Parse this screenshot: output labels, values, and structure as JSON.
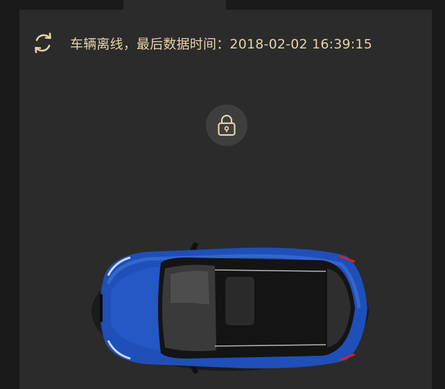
{
  "status": {
    "message": "车辆离线，最后数据时间：2018-02-02 16:39:15",
    "refresh_icon": "refresh-icon"
  },
  "controls": {
    "lock_icon": "lock-icon"
  },
  "vehicle": {
    "image": "car-top-view",
    "body_color": "#1f4fb8"
  },
  "theme": {
    "accent": "#e6d2a8",
    "background": "#1a1a1a",
    "card": "#2b2b2b"
  }
}
